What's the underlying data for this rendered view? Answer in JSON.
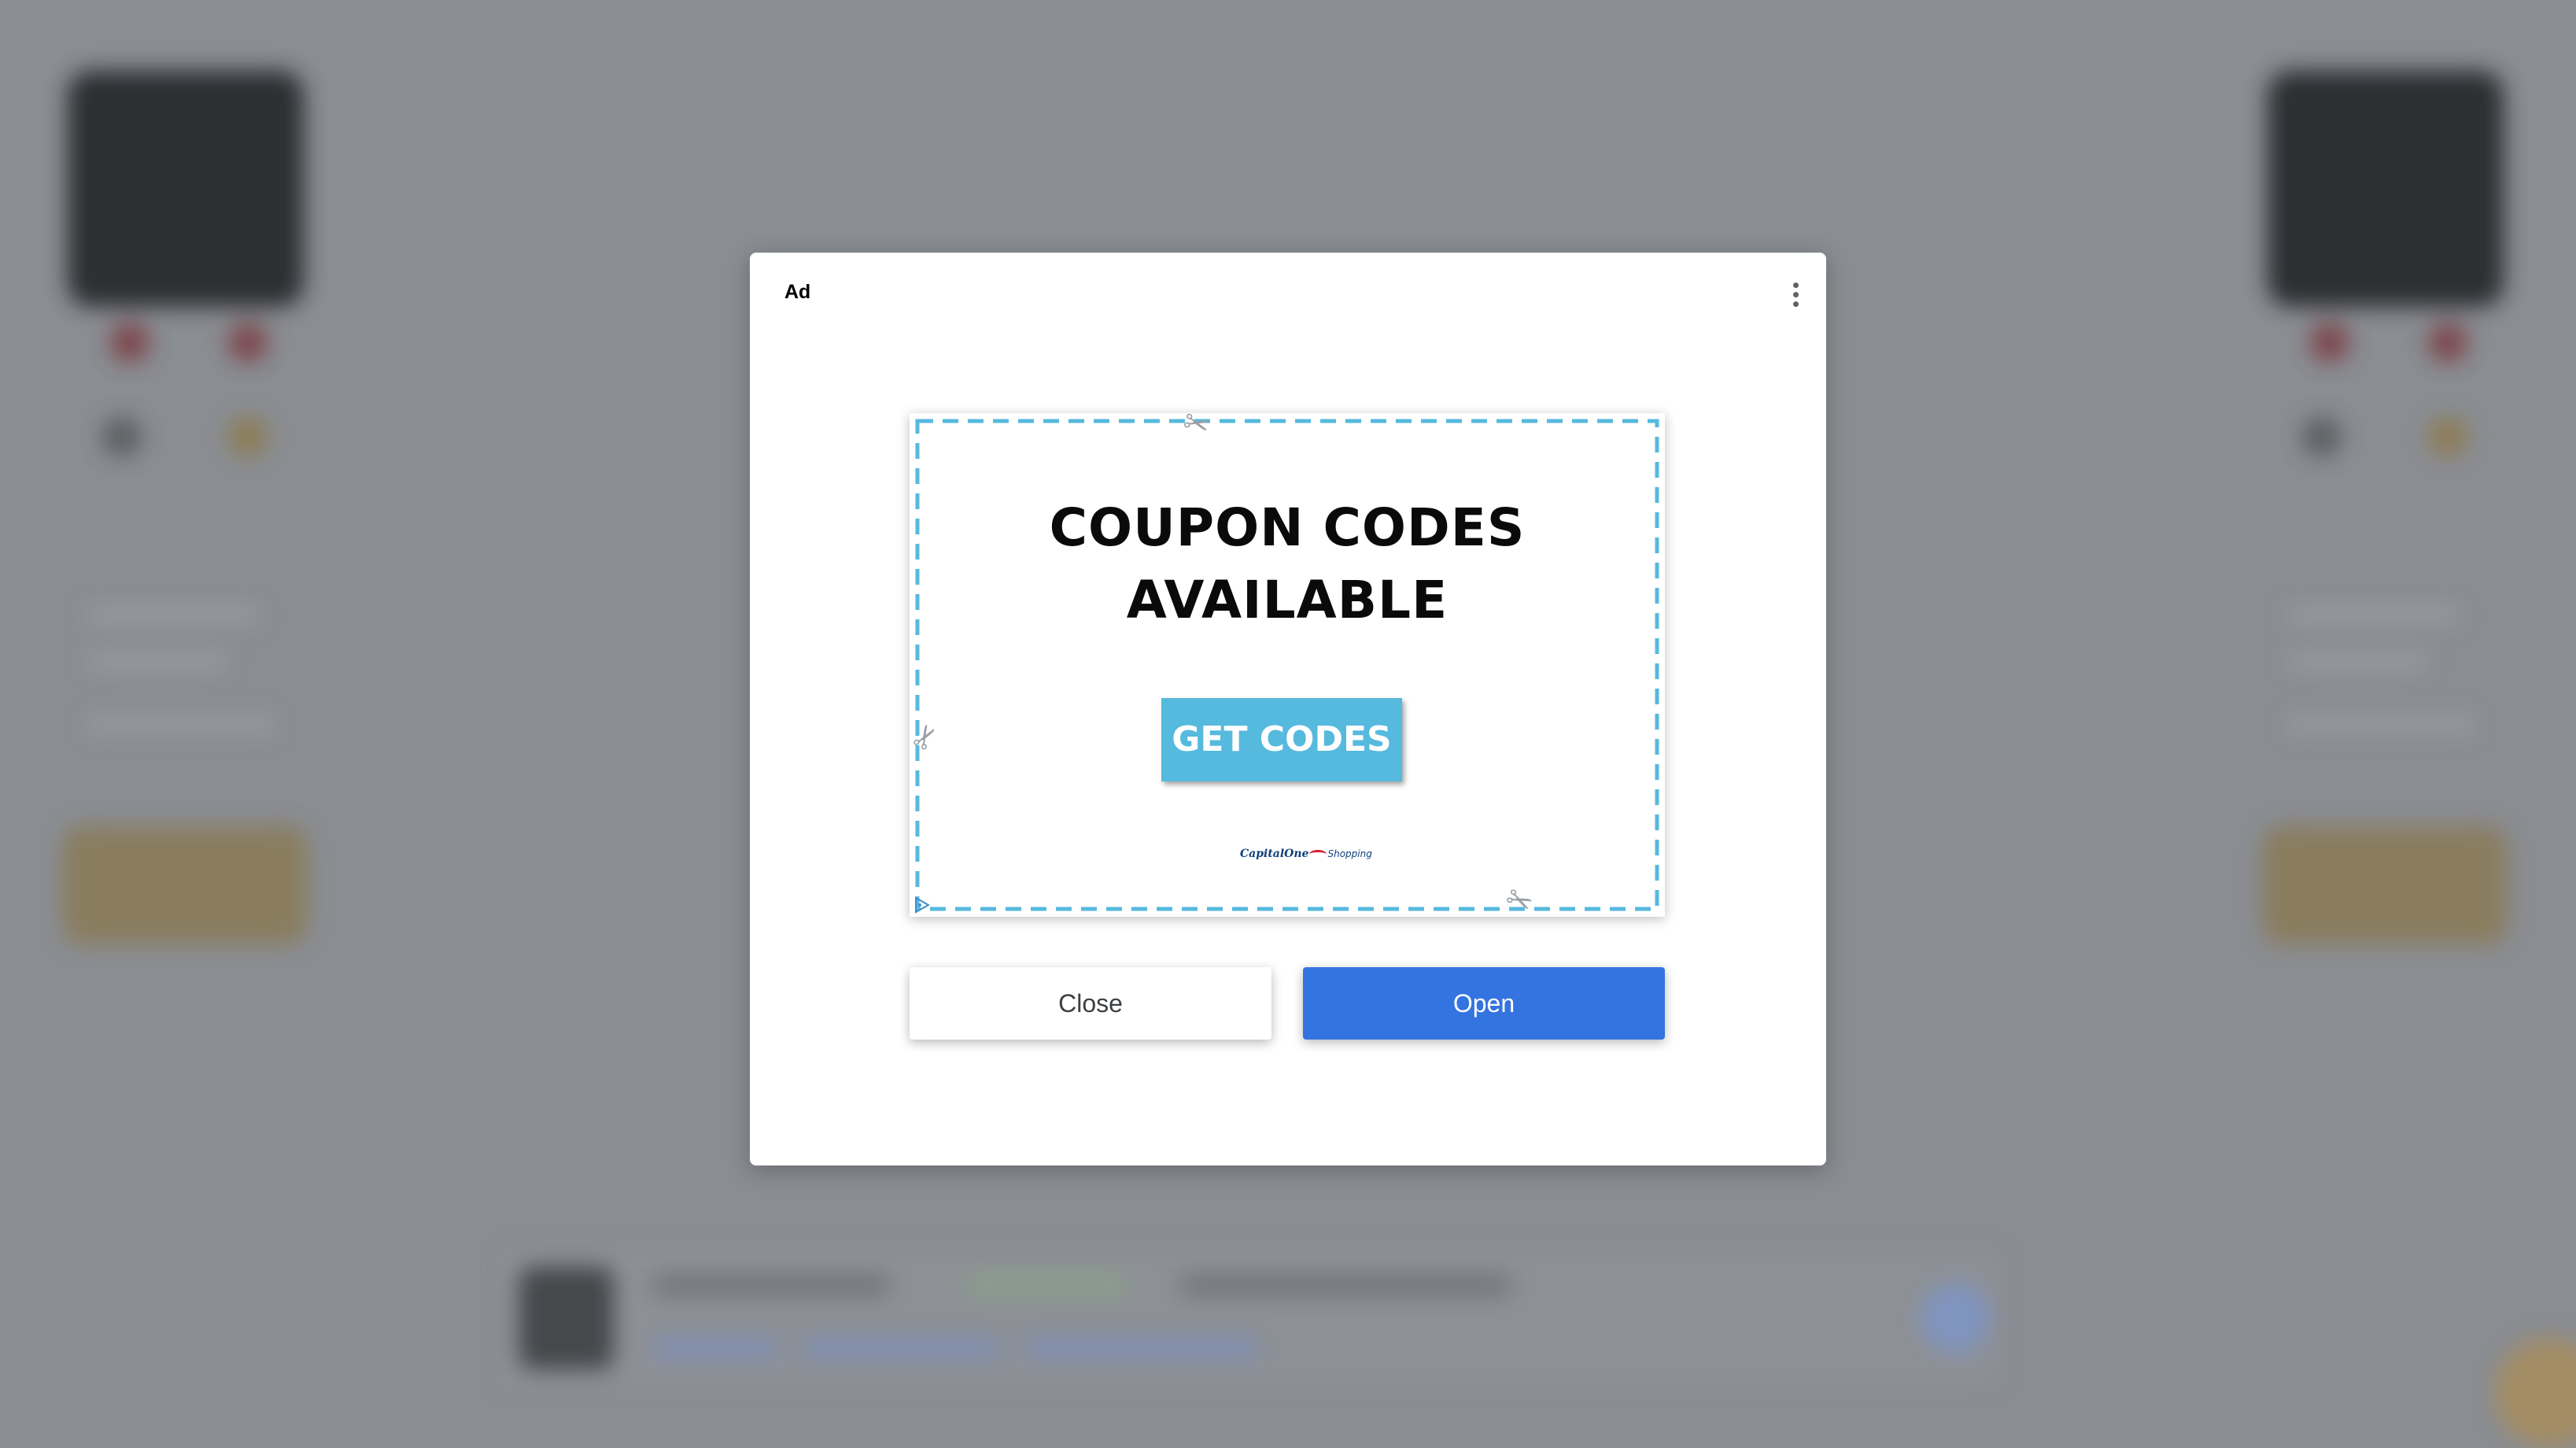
{
  "ad_dialog": {
    "label": "Ad",
    "menu_icon": "more-vert-icon",
    "creative": {
      "headline_line1": "COUPON CODES",
      "headline_line2": "AVAILABLE",
      "cta_label": "GET CODES",
      "cta_color": "#56b9de",
      "border_color": "#56b9de",
      "brand_name": "CapitalOne",
      "brand_sub": "Shopping",
      "adchoices_icon": "adchoices-icon",
      "scissors_icon": "scissors-icon"
    },
    "close_label": "Close",
    "open_label": "Open",
    "open_color": "#3474e0"
  },
  "colors": {
    "backdrop": "#8a8d92"
  }
}
